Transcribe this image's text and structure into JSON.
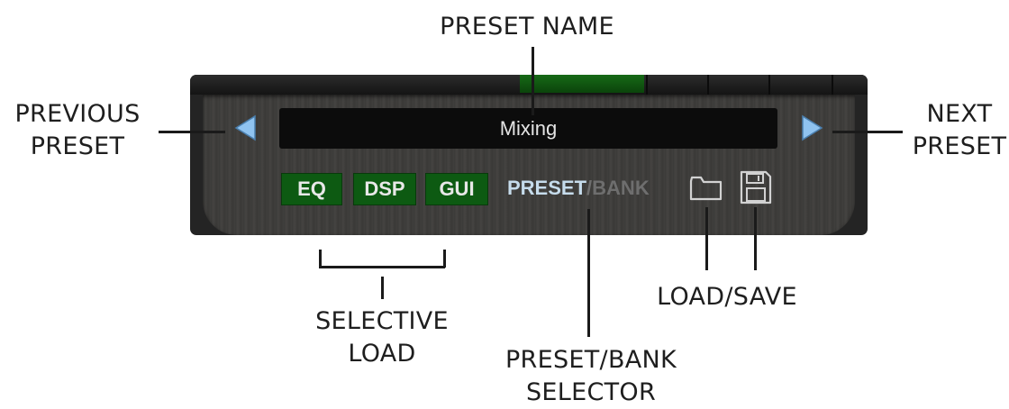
{
  "callouts": {
    "preset_name": "PRESET NAME",
    "previous_preset": "PREVIOUS\nPRESET",
    "next_preset": "NEXT\nPRESET",
    "selective_load": "SELECTIVE\nLOAD",
    "preset_bank_selector": "PRESET/BANK\nSELECTOR",
    "load_save": "LOAD/SAVE"
  },
  "panel": {
    "preset_name": "Mixing",
    "load_buttons": {
      "eq": "EQ",
      "dsp": "DSP",
      "gui": "GUI"
    },
    "selector": {
      "preset": "PRESET",
      "slash": "/",
      "bank": "BANK",
      "active": "PRESET"
    },
    "icons": {
      "prev": "left-arrow-icon",
      "next": "right-arrow-icon",
      "load": "folder-icon",
      "save": "floppy-disk-icon"
    },
    "colors": {
      "load_button_bg": "#0d5a12",
      "arrow": "#8fc3f0",
      "selector_active": "#c6dcec",
      "selector_inactive": "#6e6e6e"
    }
  }
}
